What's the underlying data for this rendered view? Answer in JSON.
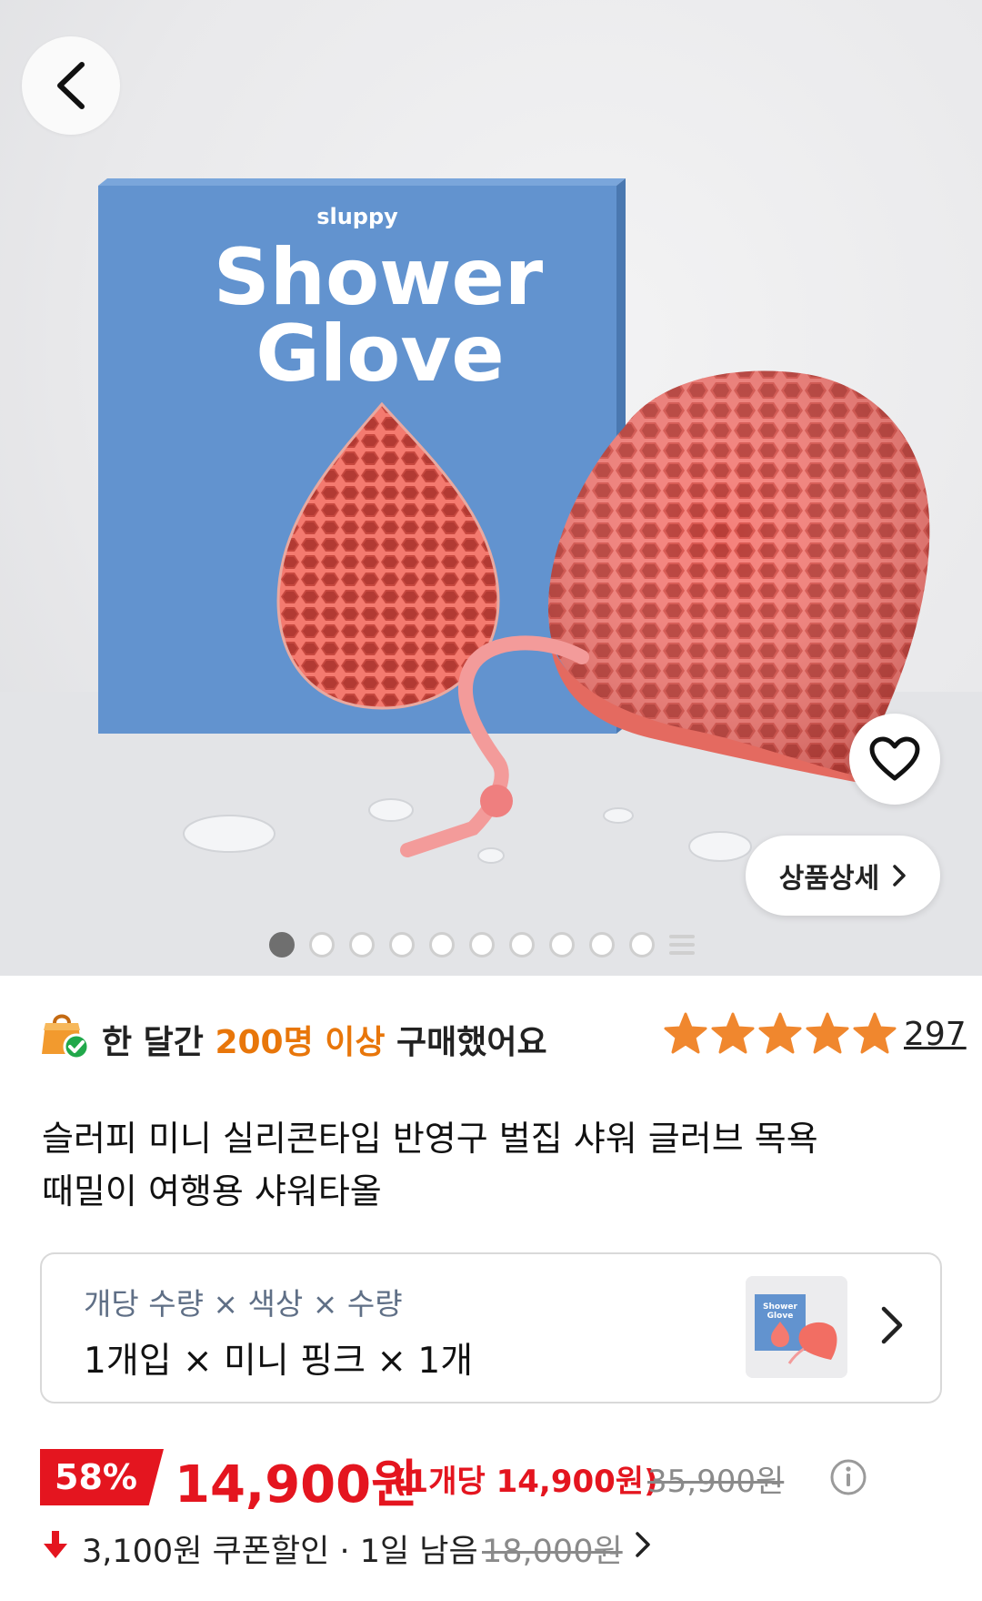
{
  "hero": {
    "box_brand": "sluppy",
    "box_title_line1": "Shower",
    "box_title_line2": "Glove",
    "detail_button_label": "상품상세",
    "image_count": 10,
    "active_image_index": 0
  },
  "stats": {
    "prefix": "한 달간 ",
    "highlight": "200명 이상",
    "suffix": " 구매했어요",
    "star_rating": 5,
    "review_count": "297"
  },
  "product": {
    "title_line1": "슬러피 미니 실리콘타입 반영구 벌집 샤워 글러브 목욕",
    "title_line2": "때밀이 여행용 샤워타올"
  },
  "option": {
    "label": "개당 수량 × 색상 × 수량",
    "value": "1개입 × 미니 핑크 × 1개",
    "thumb_title_line1": "Shower",
    "thumb_title_line2": "Glove"
  },
  "price": {
    "discount": "58%",
    "sale_price": "14,900원",
    "unit_price": "(1개당 14,900원)",
    "original_price": "35,900원"
  },
  "coupon": {
    "text": "3,100원 쿠폰할인 · 1일 남음",
    "strike_price": "18,000원"
  },
  "colors": {
    "accent_red": "#e4151f",
    "highlight_orange": "#e8760a",
    "star_orange": "#f0872e",
    "box_blue": "#6293cf",
    "glove_coral": "#f26e63"
  }
}
